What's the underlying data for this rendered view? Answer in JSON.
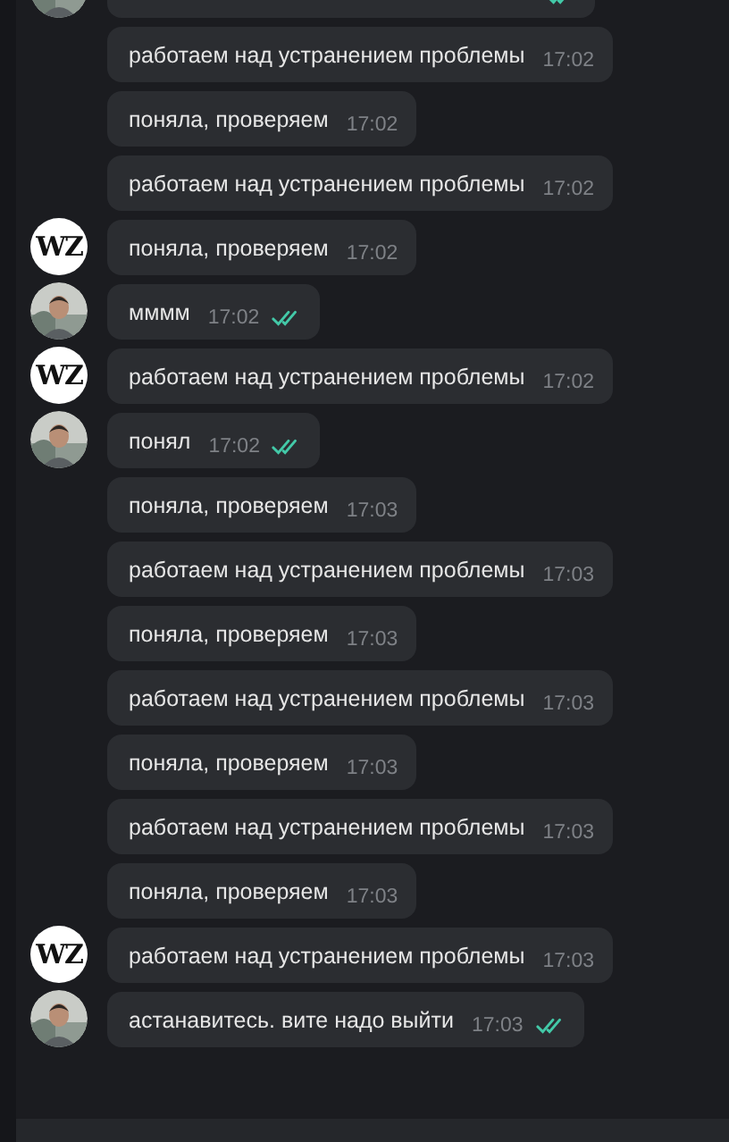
{
  "messages": [
    {
      "read": true
    },
    {
      "text": "работаем над устранением проблемы",
      "time": "17:02"
    },
    {
      "text": "поняла, проверяем",
      "time": "17:02"
    },
    {
      "text": "работаем над устранением проблемы",
      "time": "17:02"
    },
    {
      "text": "поняла, проверяем",
      "time": "17:02",
      "avatar": {
        "kind": "logo",
        "text": "WZ"
      }
    },
    {
      "text": "мммм",
      "time": "17:02",
      "read": true
    },
    {
      "text": "работаем над устранением проблемы",
      "time": "17:02",
      "avatar": {
        "kind": "logo",
        "text": "WZ"
      }
    },
    {
      "text": "понял",
      "time": "17:02",
      "read": true
    },
    {
      "text": "поняла, проверяем",
      "time": "17:03"
    },
    {
      "text": "работаем над устранением проблемы",
      "time": "17:03"
    },
    {
      "text": "поняла, проверяем",
      "time": "17:03"
    },
    {
      "text": "работаем над устранением проблемы",
      "time": "17:03"
    },
    {
      "text": "поняла, проверяем",
      "time": "17:03"
    },
    {
      "text": "работаем над устранением проблемы",
      "time": "17:03"
    },
    {
      "text": "поняла, проверяем",
      "time": "17:03"
    },
    {
      "text": "работаем над устранением проблемы",
      "time": "17:03",
      "avatar": {
        "kind": "logo",
        "text": "WZ"
      }
    },
    {
      "text": "астанавитесь. вите надо выйти",
      "time": "17:03",
      "read": true
    }
  ]
}
